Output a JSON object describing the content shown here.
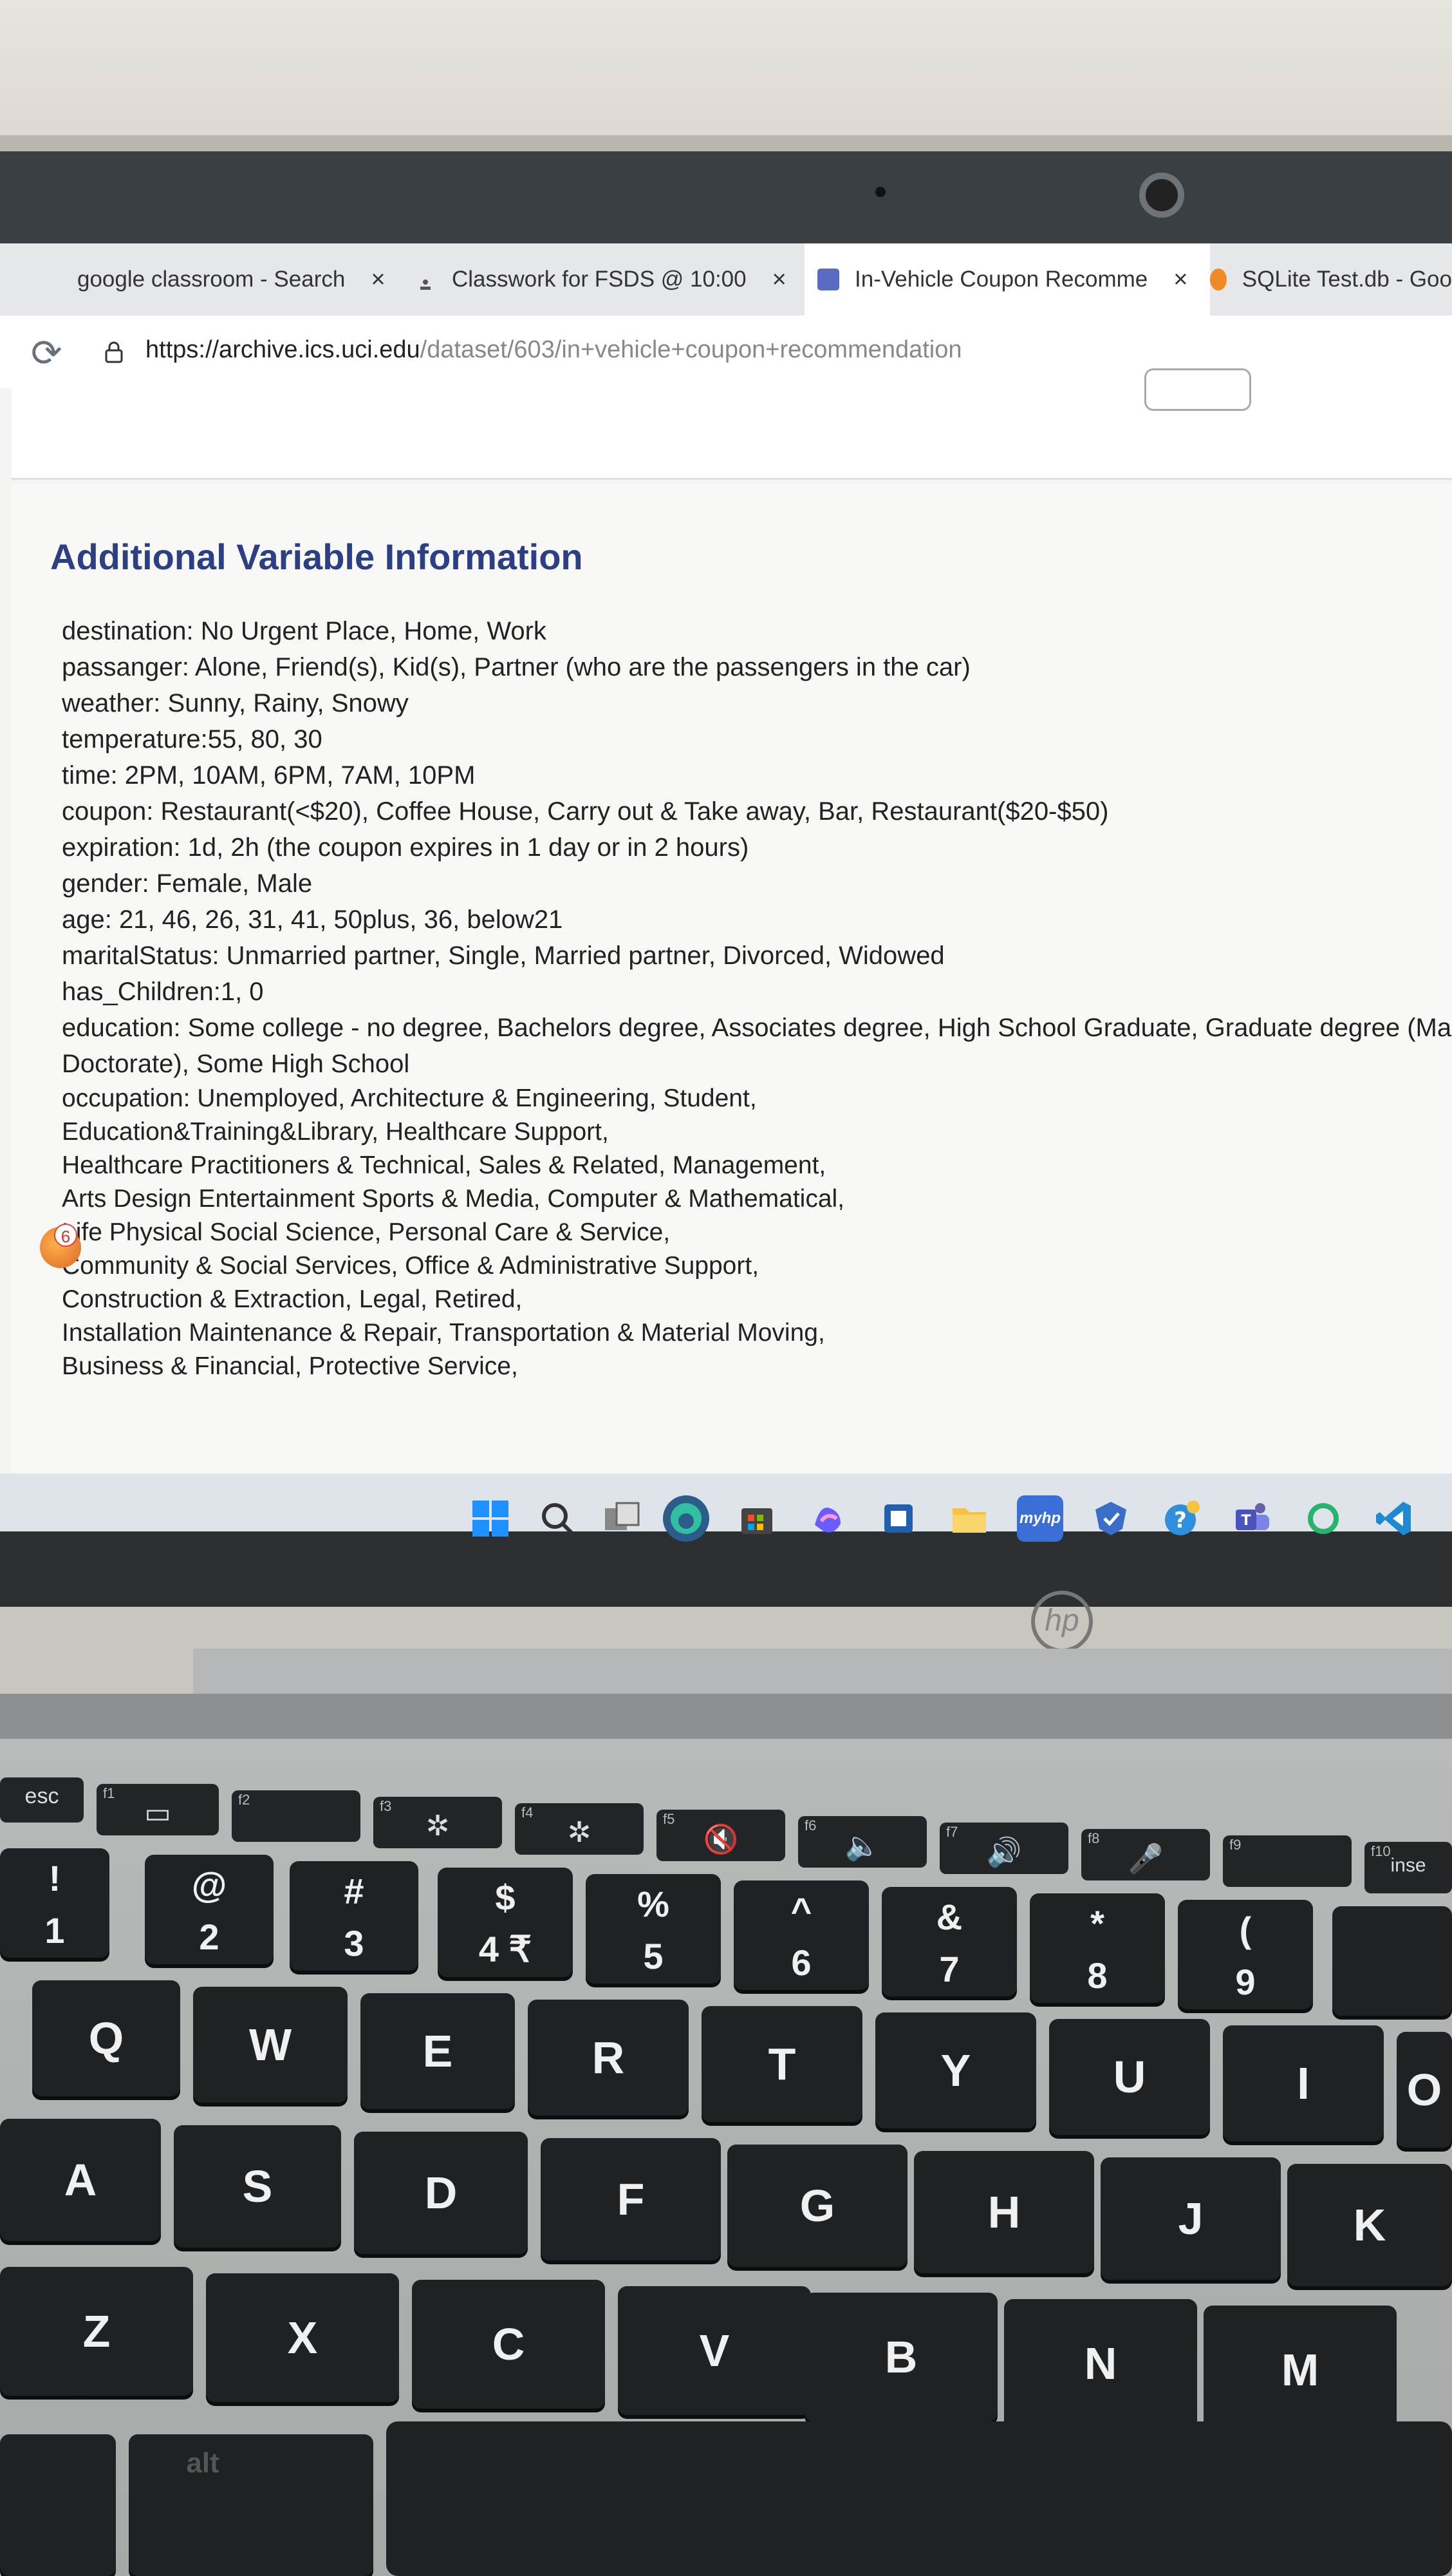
{
  "browser": {
    "tabs": [
      {
        "label": "google classroom - Search",
        "close": "×",
        "active": false
      },
      {
        "label": "Classwork for FSDS @ 10:00",
        "close": "×",
        "active": false
      },
      {
        "label": "In-Vehicle Coupon Recomme",
        "close": "×",
        "active": true
      },
      {
        "label": "SQLite Test.db - Goo",
        "close": "",
        "active": false
      }
    ],
    "url_host": "https://archive.ics.uci.edu",
    "url_path": "/dataset/603/in+vehicle+coupon+recommendation"
  },
  "page": {
    "heading": "Additional Variable Information",
    "lines": [
      "destination: No Urgent Place, Home, Work",
      "passanger: Alone, Friend(s), Kid(s), Partner (who are the passengers in the car)",
      "weather: Sunny, Rainy, Snowy",
      "temperature:55, 80, 30",
      "time: 2PM, 10AM, 6PM, 7AM, 10PM",
      "coupon: Restaurant(<$20), Coffee House, Carry out & Take away, Bar, Restaurant($20-$50)",
      "expiration: 1d, 2h (the coupon expires in 1 day or in 2 hours)",
      "gender: Female, Male",
      "age: 21, 46, 26, 31, 41, 50plus, 36, below21",
      "maritalStatus: Unmarried partner, Single, Married partner, Divorced, Widowed",
      "has_Children:1, 0",
      "education: Some college - no degree, Bachelors degree, Associates degree, High School Graduate, Graduate degree (Ma",
      "Doctorate), Some High School",
      "occupation: Unemployed, Architecture & Engineering, Student,",
      "Education&Training&Library, Healthcare Support,",
      "Healthcare Practitioners & Technical, Sales & Related, Management,",
      "Arts Design Entertainment Sports & Media, Computer & Mathematical,",
      "Life Physical Social Science, Personal Care & Service,",
      "Community & Social Services, Office & Administrative Support,",
      "Construction & Extraction, Legal, Retired,",
      "Installation Maintenance & Repair, Transportation & Material Moving,",
      "Business & Financial, Protective Service,"
    ]
  },
  "taskbar": {
    "notification_count": "6",
    "icons": [
      "windows-start-icon",
      "search-icon",
      "task-view-icon",
      "edge-icon",
      "store-icon",
      "copilot-icon",
      "app-icon",
      "file-explorer-icon",
      "myhp-icon",
      "security-icon",
      "help-icon",
      "teams-icon",
      "circle-app-icon",
      "vscode-icon"
    ],
    "myhp_label": "myhp"
  },
  "laptop": {
    "brand": "hp",
    "function_keys": [
      {
        "num": "",
        "sym": "esc"
      },
      {
        "num": "f1",
        "sym": "▭"
      },
      {
        "num": "f2",
        "sym": ""
      },
      {
        "num": "f3",
        "sym": "✲"
      },
      {
        "num": "f4",
        "sym": "✲"
      },
      {
        "num": "f5",
        "sym": "🔇"
      },
      {
        "num": "f6",
        "sym": "🔈"
      },
      {
        "num": "f7",
        "sym": "🔊"
      },
      {
        "num": "f8",
        "sym": "🎤"
      },
      {
        "num": "f9",
        "sym": ""
      },
      {
        "num": "f10",
        "sym": "inse"
      }
    ],
    "number_keys": [
      {
        "top": "!",
        "bot": "1"
      },
      {
        "top": "@",
        "bot": "2"
      },
      {
        "top": "#",
        "bot": "3"
      },
      {
        "top": "$",
        "bot": "4 ₹"
      },
      {
        "top": "%",
        "bot": "5"
      },
      {
        "top": "^",
        "bot": "6"
      },
      {
        "top": "&",
        "bot": "7"
      },
      {
        "top": "*",
        "bot": "8"
      },
      {
        "top": "(",
        "bot": "9"
      }
    ],
    "row_q": [
      "Q",
      "W",
      "E",
      "R",
      "T",
      "Y",
      "U",
      "I",
      "O"
    ],
    "row_a": [
      "A",
      "S",
      "D",
      "F",
      "G",
      "H",
      "J",
      "K"
    ],
    "row_z": [
      "Z",
      "X",
      "C",
      "V",
      "B",
      "N",
      "M"
    ],
    "alt_label": "alt"
  }
}
